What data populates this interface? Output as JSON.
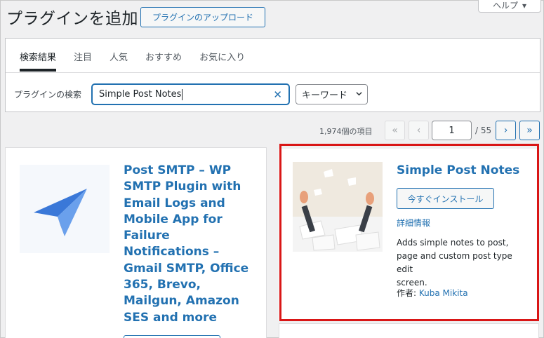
{
  "header": {
    "title": "プラグインを追加",
    "upload_button": "プラグインのアップロード",
    "help_button": "ヘルプ"
  },
  "tabs": [
    {
      "label": "検索結果",
      "active": true
    },
    {
      "label": "注目",
      "active": false
    },
    {
      "label": "人気",
      "active": false
    },
    {
      "label": "おすすめ",
      "active": false
    },
    {
      "label": "お気に入り",
      "active": false
    }
  ],
  "search": {
    "label": "プラグインの検索",
    "value": "Simple Post Notes",
    "type_select": "キーワード"
  },
  "pagination": {
    "item_count": "1,974個の項目",
    "first": "«",
    "prev": "‹",
    "current_page": "1",
    "total_pages": "/ 55",
    "next": "›",
    "last": "»"
  },
  "plugins": [
    {
      "title_lines": [
        "Post SMTP – WP",
        "SMTP Plugin with",
        "Email Logs and",
        "Mobile App for",
        "Failure",
        "Notifications –",
        "Gmail SMTP, Office",
        "365, Brevo,",
        "Mailgun, Amazon",
        "SES and more"
      ],
      "icon": "paper-plane-icon"
    },
    {
      "title": "Simple Post Notes",
      "install_button": "今すぐインストール",
      "details_link": "詳細情報",
      "description": [
        "Adds simple notes to post,",
        "page and custom post type edit",
        "screen."
      ],
      "author_label": "作者:",
      "author_name": "Kuba Mikita",
      "icon": "hands-papers-icon"
    }
  ],
  "colors": {
    "accent": "#2271b1",
    "highlight": "#d91616"
  }
}
